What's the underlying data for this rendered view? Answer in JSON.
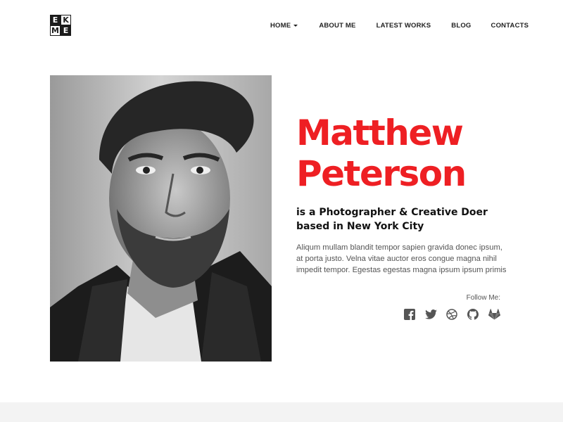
{
  "logo": {
    "letters": [
      "E",
      "K",
      "M",
      "E"
    ]
  },
  "nav": {
    "items": [
      {
        "label": "HOME"
      },
      {
        "label": "ABOUT ME"
      },
      {
        "label": "LATEST WORKS"
      },
      {
        "label": "BLOG"
      },
      {
        "label": "CONTACTS"
      }
    ]
  },
  "hero": {
    "first_name": "Matthew",
    "last_name": "Peterson",
    "tagline_line1": "is a Photographer & Creative Doer",
    "tagline_line2": "based in New York City",
    "description": "Aliqum mullam blandit tempor sapien gravida donec ipsum, at porta justo. Velna vitae auctor eros congue magna nihil impedit tempor. Egestas egestas magna ipsum ipsum primis",
    "follow_label": "Follow Me:"
  },
  "socials": [
    "facebook-icon",
    "twitter-icon",
    "dribbble-icon",
    "github-icon",
    "gitlab-icon"
  ],
  "colors": {
    "accent": "#ee1f23",
    "text": "#111111",
    "muted": "#555555",
    "footer_band": "#f3f3f3"
  }
}
